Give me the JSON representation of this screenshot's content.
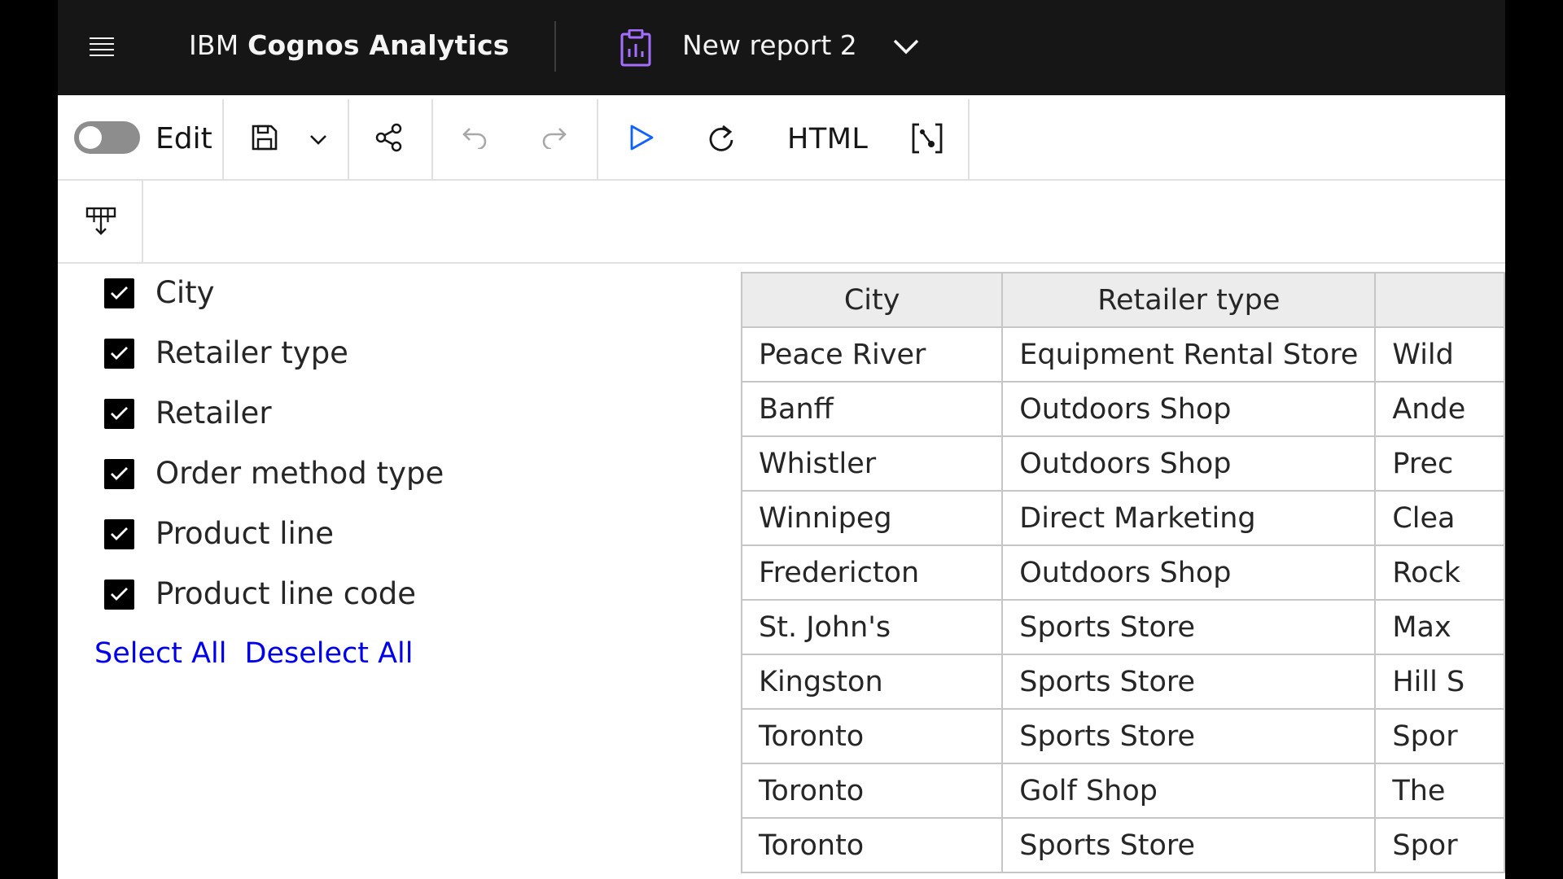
{
  "header": {
    "brand_prefix": "IBM ",
    "brand_name": "Cognos Analytics",
    "report_title": "New report 2"
  },
  "toolbar": {
    "edit_label": "Edit",
    "edit_toggle_on": false,
    "html_label": "HTML",
    "icons": [
      "save-icon",
      "chevron-down-icon",
      "share-icon",
      "undo-icon",
      "redo-icon",
      "run-icon",
      "refresh-icon",
      "html-format",
      "data-view-icon"
    ]
  },
  "columns_panel": {
    "items": [
      {
        "label": "City",
        "checked": true
      },
      {
        "label": "Retailer type",
        "checked": true
      },
      {
        "label": "Retailer",
        "checked": true
      },
      {
        "label": "Order method type",
        "checked": true
      },
      {
        "label": "Product line",
        "checked": true
      },
      {
        "label": "Product line code",
        "checked": true
      }
    ],
    "select_all": "Select All",
    "deselect_all": "Deselect All"
  },
  "table": {
    "headers": [
      "City",
      "Retailer type",
      ""
    ],
    "rows": [
      [
        "Peace River",
        "Equipment Rental Store",
        "Wild"
      ],
      [
        "Banff",
        "Outdoors Shop",
        "Ande"
      ],
      [
        "Whistler",
        "Outdoors Shop",
        "Prec"
      ],
      [
        "Winnipeg",
        "Direct Marketing",
        "Clea"
      ],
      [
        "Fredericton",
        "Outdoors Shop",
        "Rock"
      ],
      [
        "St. John's",
        "Sports Store",
        "Max"
      ],
      [
        "Kingston",
        "Sports Store",
        "Hill S"
      ],
      [
        "Toronto",
        "Sports Store",
        "Spor"
      ],
      [
        "Toronto",
        "Golf Shop",
        "The "
      ],
      [
        "Toronto",
        "Sports Store",
        "Spor"
      ]
    ]
  },
  "colors": {
    "header_bg": "#161616",
    "accent_run": "#0f62fe",
    "accent_report_icon": "#a56eff",
    "link": "#0000ee"
  }
}
